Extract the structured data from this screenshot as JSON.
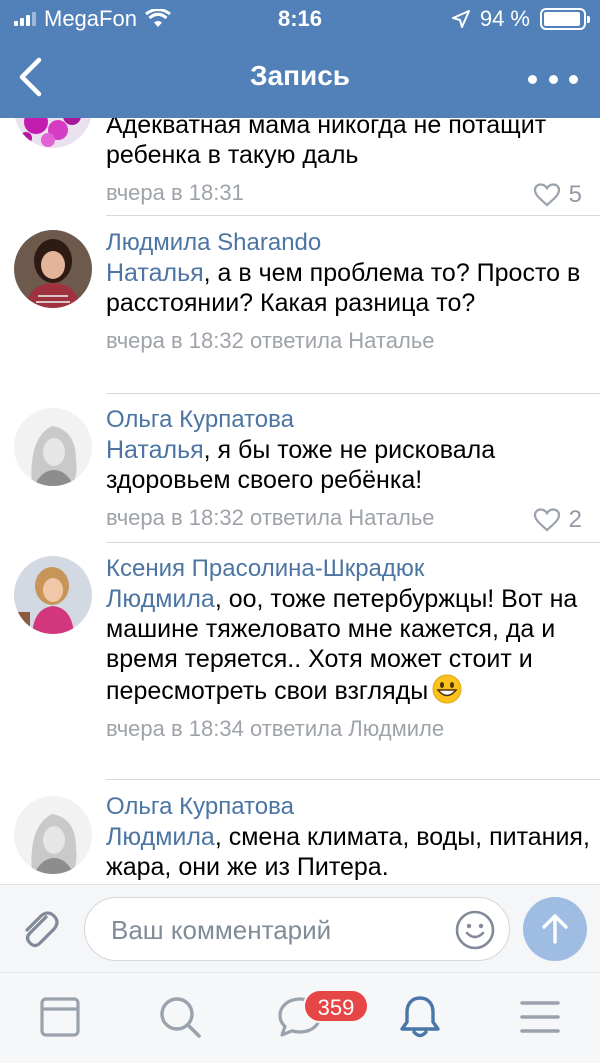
{
  "status_bar": {
    "carrier": "MegaFon",
    "time": "8:16",
    "battery_percent": "94 %",
    "battery_level": 0.94
  },
  "nav": {
    "title": "Запись",
    "back_icon": "chevron-left-icon",
    "more_icon": "more-dots-icon"
  },
  "comments": [
    {
      "author": "",
      "text": "Адекватная мама никогда не потащит ребенка в такую даль",
      "time": "вчера в 18:31",
      "reply_to": "",
      "likes": "5"
    },
    {
      "author": "Людмила Sharando",
      "mention": "Наталья",
      "text": ", а в чем проблема то? Просто в расстоянии? Какая разница то?",
      "time": "вчера в 18:32",
      "reply_to": "ответила Наталье",
      "likes": ""
    },
    {
      "author": "Ольга Курпатова",
      "mention": "Наталья",
      "text": ", я бы тоже не рисковала здоровьем своего ребёнка!",
      "time": "вчера в 18:32",
      "reply_to": "ответила Наталье",
      "likes": "2"
    },
    {
      "author": "Ксения Прасолина-Шкрадюк",
      "mention": "Людмила",
      "text": ", оо, тоже петербуржцы! Вот на машине тяжеловато мне кажется, да и время теряется.. Хотя может стоит и пересмотреть свои взгляды",
      "time": "вчера в 18:34",
      "reply_to": "ответила Людмиле",
      "likes": ""
    },
    {
      "author": "Ольга Курпатова",
      "mention": "Людмила",
      "text": ", смена климата,  воды, питания, жара, они же из Питера.",
      "time": "",
      "reply_to": "",
      "likes": ""
    }
  ],
  "composer": {
    "placeholder": "Ваш комментарий",
    "value": ""
  },
  "tabbar": {
    "items": [
      "news-icon",
      "search-icon",
      "messages-icon",
      "notifications-icon",
      "menu-icon"
    ],
    "messages_badge": "359",
    "active": "notifications-icon"
  },
  "colors": {
    "header": "#5181b8",
    "link": "#4c75a3",
    "meta": "#9ea3a9",
    "badge": "#e64646",
    "send_button": "#9fbde2"
  }
}
